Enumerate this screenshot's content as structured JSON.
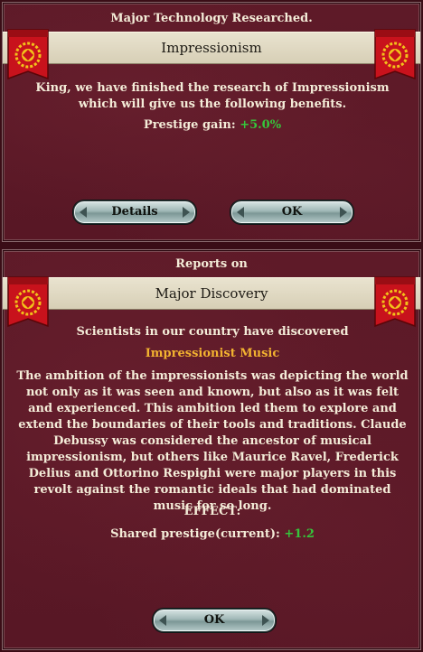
{
  "tech_popup": {
    "header": "Major Technology Researched.",
    "title": "Impressionism",
    "message": "King, we have finished the research of Impressionism which will give us the following benefits.",
    "prestige_label": "Prestige gain:",
    "prestige_value": "+5.0%",
    "details_button": "Details",
    "ok_button": "OK"
  },
  "discovery_popup": {
    "header": "Reports on",
    "title": "Major Discovery",
    "intro": "Scientists in our country have discovered",
    "discovery_name": "Impressionist Music",
    "description": "The ambition of the impressionists was depicting the world not only as it was seen and known, but also as it was felt and experienced. This ambition led them to explore and extend the boundaries of their tools and traditions. Claude Debussy was considered the ancestor of musical impressionism, but others like Maurice Ravel, Frederick Delius and Ottorino Respighi were major players in this revolt against the romantic ideals that had dominated music for so long.",
    "effect_label": "EFFECT:",
    "shared_prestige_label": "Shared prestige(current):",
    "shared_prestige_value": "+1.2",
    "ok_button": "OK"
  },
  "icons": {
    "flag": "laurel-wreath-eagle-banner-icon"
  },
  "colors": {
    "panel_bg": "#5e1a28",
    "title_band": "#e2dbc4",
    "positive_value": "#35c63b",
    "discovery_name": "#f2b230",
    "banner_red": "#c8121c",
    "emblem_gold": "#f2c21a"
  }
}
